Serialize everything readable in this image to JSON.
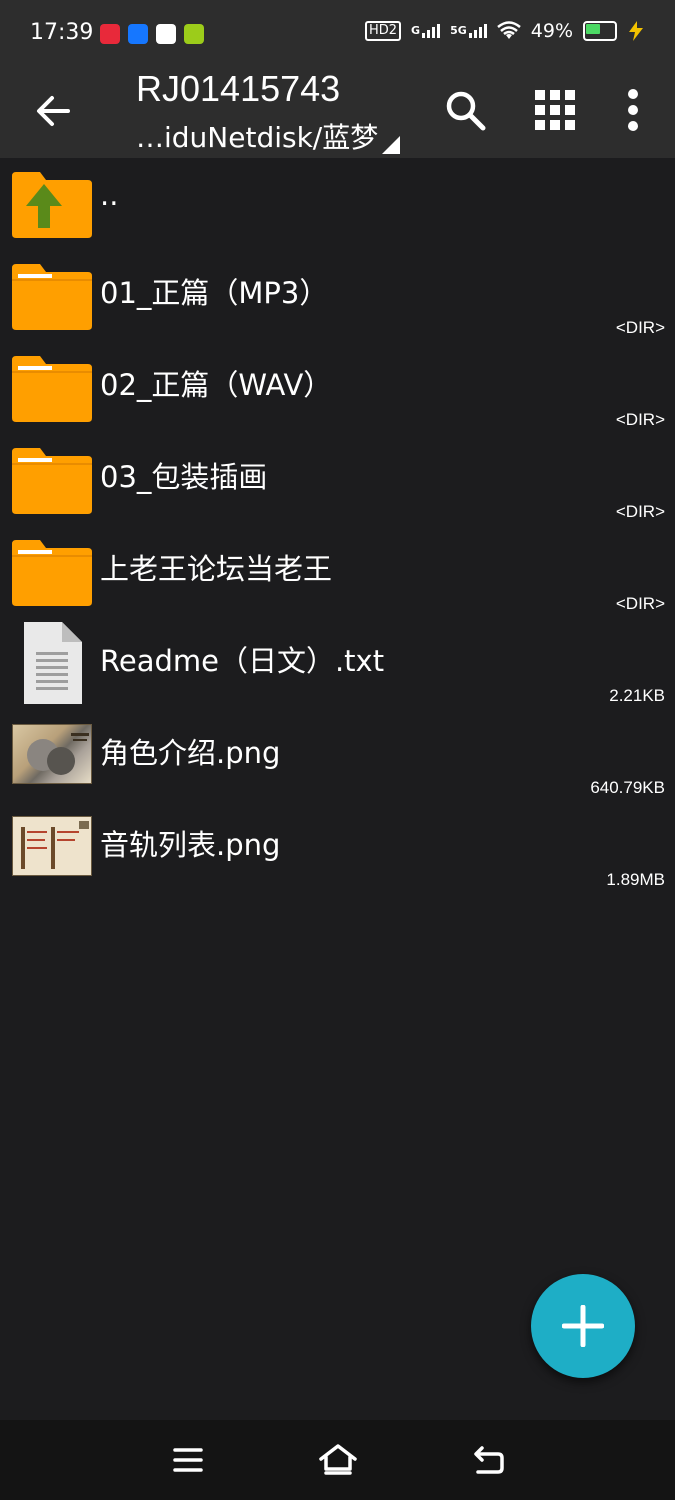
{
  "status": {
    "time": "17:39",
    "battery": "49%",
    "network_labels": [
      "HD2",
      "G",
      "5G"
    ]
  },
  "appbar": {
    "title": "RJ01415743",
    "path": "…iduNetdisk/蓝梦"
  },
  "files": [
    {
      "name": "..",
      "meta": "",
      "kind": "parent"
    },
    {
      "name": "01_正篇（MP3）",
      "meta": "<DIR>",
      "kind": "folder"
    },
    {
      "name": "02_正篇（WAV）",
      "meta": "<DIR>",
      "kind": "folder"
    },
    {
      "name": "03_包装插画",
      "meta": "<DIR>",
      "kind": "folder"
    },
    {
      "name": "上老王论坛当老王",
      "meta": "<DIR>",
      "kind": "folder"
    },
    {
      "name": "Readme（日文）.txt",
      "meta": "2.21KB",
      "kind": "text-file"
    },
    {
      "name": "角色介绍.png",
      "meta": "640.79KB",
      "kind": "image"
    },
    {
      "name": "音轨列表.png",
      "meta": "1.89MB",
      "kind": "image"
    }
  ],
  "colors": {
    "background": "#1c1c1e",
    "bar": "#2d2d2d",
    "folder": "#ff9f00",
    "fab": "#1eaec6",
    "parent_arrow": "#5a8a1a",
    "battery_fill": "#4cd964"
  }
}
